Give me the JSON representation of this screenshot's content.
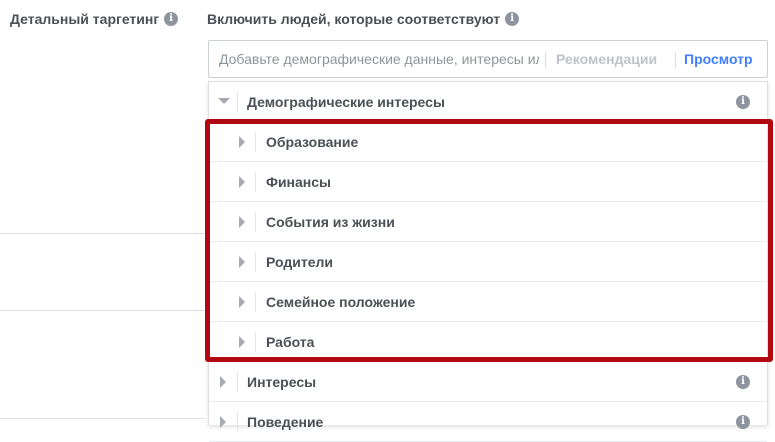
{
  "left_label": {
    "text": "Детальный таргетинг",
    "icon": "info-icon"
  },
  "right_label": {
    "text": "Включить людей, которые соответствуют",
    "icon": "info-icon"
  },
  "search": {
    "placeholder": "Добавьте демографические данные, интересы или действия",
    "suggestions_label": "Рекомендации",
    "browse_label": "Просмотр"
  },
  "colors": {
    "link": "#4080ff",
    "muted_link": "#bec3c9",
    "highlight_border": "#b00a10",
    "text": "#4b4f56"
  },
  "category": {
    "label": "Демографические интересы",
    "expanded": true,
    "icon": "info-icon",
    "subitems": [
      {
        "label": "Образование"
      },
      {
        "label": "Финансы"
      },
      {
        "label": "События из жизни"
      },
      {
        "label": "Родители"
      },
      {
        "label": "Семейное положение"
      },
      {
        "label": "Работа"
      }
    ]
  },
  "other_categories": [
    {
      "label": "Интересы",
      "icon": "info-icon"
    },
    {
      "label": "Поведение",
      "icon": "info-icon"
    }
  ],
  "info_glyph": "i"
}
